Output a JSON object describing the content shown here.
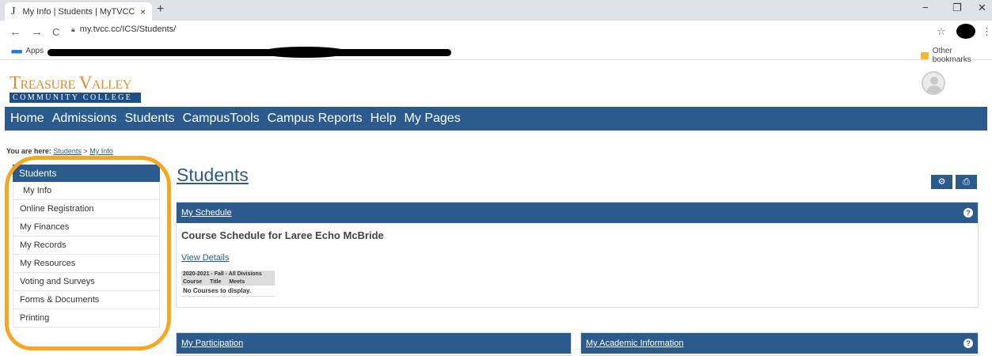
{
  "browser": {
    "tab_icon": "J",
    "tab_title": "My Info | Students | MyTVCC",
    "tab_close": "×",
    "new_tab": "+",
    "url": "my.tvcc.cc/ICS/Students/",
    "apps_label": "Apps",
    "other_bookmarks": "Other bookmarks",
    "back": "←",
    "forward": "→",
    "reload": "C",
    "star": "☆",
    "menu": "⋮",
    "minimize": "−",
    "restore": "❐",
    "close": "✕"
  },
  "site": {
    "logo_line1": "Treasure Valley",
    "logo_line2": "COMMUNITY COLLEGE",
    "nav": [
      "Home",
      "Admissions",
      "Students",
      "CampusTools",
      "Campus Reports",
      "Help",
      "My Pages"
    ]
  },
  "breadcrumb": {
    "label": "You are here:",
    "crumbs": [
      "Students",
      "My Info"
    ],
    "separator": ">"
  },
  "sidebar": {
    "title": "Students",
    "items": [
      "My Info",
      "Online Registration",
      "My Finances",
      "My Records",
      "My Resources",
      "Voting and Surveys",
      "Forms & Documents",
      "Printing"
    ]
  },
  "main": {
    "page_title": "Students",
    "schedule": {
      "title": "My Schedule",
      "heading": "Course Schedule for Laree Echo McBride",
      "view_details": "View Details",
      "term": "2020-2021 - Fall - All Divisions",
      "columns": [
        "Course",
        "Title",
        "Meets"
      ],
      "empty": "No Courses to display."
    },
    "participation_title": "My Participation",
    "academic_title": "My Academic Information",
    "help_glyph": "?"
  },
  "colors": {
    "brand_blue": "#2a5b8c",
    "logo_orange": "#d98e2b",
    "highlight": "#f5a623"
  }
}
